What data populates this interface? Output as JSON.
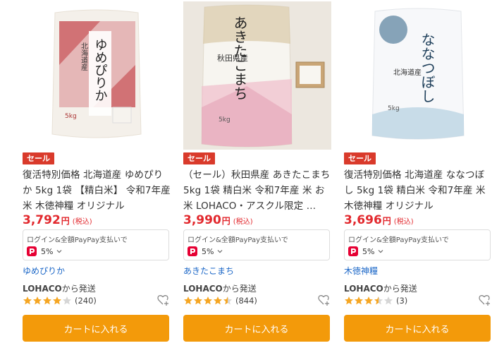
{
  "products": [
    {
      "name": "yumepirika",
      "sale_label": "セール",
      "title": "復活特別価格 北海道産 ゆめぴりか 5kg 1袋 【精白米】 令和7年産 米 木徳神糧 オリジナル",
      "price": "3,792",
      "yen": "円",
      "tax": "(税込)",
      "pay_note": "ログイン&全額PayPay支払いで",
      "pay_rate": "5%",
      "brand": "ゆめぴりか",
      "shipper_brand": "LOHACO",
      "shipper_suffix": "から発送",
      "rating_value": 4,
      "review_count": "(240)",
      "cart_label": "カートに入れる",
      "package_text": "ゆめぴりか",
      "package_region": "北海道産",
      "package_weight": "5kg",
      "package_color": "#c13a3f"
    },
    {
      "name": "akitakomachi",
      "sale_label": "セール",
      "title": "（セール）秋田県産 あきたこまち 5kg 1袋 精白米 令和7年産 米 お米 LOHACO・アスクル限定 …",
      "price": "3,990",
      "yen": "円",
      "tax": "(税込)",
      "pay_note": "ログイン&全額PayPay支払いで",
      "pay_rate": "5%",
      "brand": "あきたこまち",
      "shipper_brand": "LOHACO",
      "shipper_suffix": "から発送",
      "rating_value": 4.5,
      "review_count": "(844)",
      "cart_label": "カートに入れる",
      "package_text": "あきたこまち",
      "package_region": "秋田県産",
      "package_weight": "5kg",
      "package_color": "#e5a3b5"
    },
    {
      "name": "nanatsuboshi",
      "sale_label": "セール",
      "title": "復活特別価格 北海道産 ななつぼし 5kg 1袋 精白米 令和7年産 米 木徳神糧 オリジナル",
      "price": "3,696",
      "yen": "円",
      "tax": "(税込)",
      "pay_note": "ログイン&全額PayPay支払いで",
      "pay_rate": "5%",
      "brand": "木徳神糧",
      "shipper_brand": "LOHACO",
      "shipper_suffix": "から発送",
      "rating_value": 3.5,
      "review_count": "(3)",
      "cart_label": "カートに入れる",
      "package_text": "ななつぼし",
      "package_region": "北海道産",
      "package_weight": "5kg",
      "package_color": "#3a6b8c"
    }
  ],
  "colors": {
    "sale": "#d93a2b",
    "price": "#e2282d",
    "cart_button": "#f39a0a",
    "brand_link": "#1a66c7",
    "star": "#f5a623",
    "paypay": "#e60033"
  },
  "icons": {
    "favorite": "heart-plus-icon",
    "paypay": "paypay-icon",
    "chevron": "chevron-down-icon",
    "star": "star-icon"
  }
}
